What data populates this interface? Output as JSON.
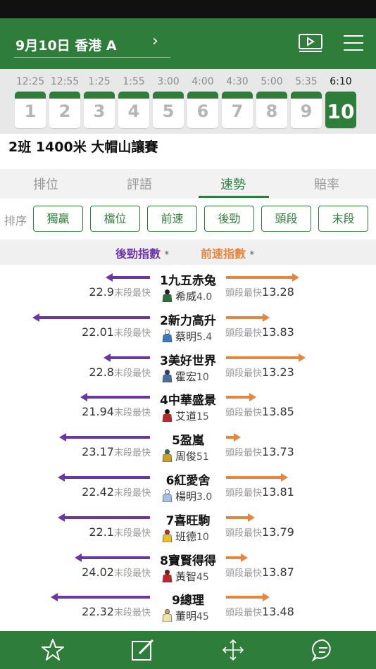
{
  "header": {
    "meeting": "9月10日 香港 A",
    "meeting_arrow": "›",
    "icons": [
      "video-icon",
      "menu-icon"
    ]
  },
  "races": [
    {
      "time": "12:25",
      "num": "1",
      "active": false
    },
    {
      "time": "12:55",
      "num": "2",
      "active": false
    },
    {
      "time": "1:25",
      "num": "3",
      "active": false
    },
    {
      "time": "1:55",
      "num": "4",
      "active": false
    },
    {
      "time": "3:00",
      "num": "5",
      "active": false
    },
    {
      "time": "4:00",
      "num": "6",
      "active": false
    },
    {
      "time": "4:30",
      "num": "7",
      "active": false
    },
    {
      "time": "5:00",
      "num": "8",
      "active": false
    },
    {
      "time": "5:35",
      "num": "9",
      "active": false
    },
    {
      "time": "6:10",
      "num": "10",
      "active": true
    }
  ],
  "race_title": "2班 1400米 大帽山讓賽",
  "tabs": [
    "排位",
    "評語",
    "速勢",
    "賠率"
  ],
  "active_tab": "速勢",
  "sort": {
    "label": "排序",
    "buttons": [
      "獨贏",
      "檔位",
      "前速",
      "後勁",
      "頭段",
      "末段"
    ]
  },
  "legend": {
    "late": "後勁指數",
    "early": "前速指數",
    "star": "*"
  },
  "captions": {
    "late": "末段最快",
    "early": "頭段最快"
  },
  "colors": {
    "brand": "#2e7d3a",
    "late": "#6b35a8",
    "early": "#e8843c"
  },
  "horses": [
    {
      "name": "1九五赤兔",
      "jockey": "希威",
      "weight": "4.0",
      "late": "22.9",
      "early": "13.28",
      "late_arrow": 0.37,
      "early_arrow": 0.74,
      "silk": [
        "#2f6f3a",
        "#222"
      ]
    },
    {
      "name": "2新力高升",
      "jockey": "蔡明",
      "weight": "5.4",
      "late": "22.01",
      "early": "13.83",
      "late_arrow": 0.98,
      "early_arrow": 0.44,
      "silk": [
        "#3a7bbf",
        "#fff"
      ]
    },
    {
      "name": "3美好世界",
      "jockey": "霍宏",
      "weight": "10",
      "late": "22.8",
      "early": "13.23",
      "late_arrow": 0.39,
      "early_arrow": 0.81,
      "silk": [
        "#4a6fa0",
        "#2a3f60"
      ]
    },
    {
      "name": "4中華盛景",
      "jockey": "艾道",
      "weight": "15",
      "late": "21.94",
      "early": "13.85",
      "late_arrow": 0.58,
      "early_arrow": 0.31,
      "silk": [
        "#c0272d",
        "#111"
      ]
    },
    {
      "name": "5盈嵐",
      "jockey": "周俊",
      "weight": "51",
      "late": "23.17",
      "early": "13.73",
      "late_arrow": 0.76,
      "early_arrow": 0.15,
      "silk": [
        "#c9a227",
        "#3a6e5a"
      ]
    },
    {
      "name": "6紅愛舍",
      "jockey": "楊明",
      "weight": "3.0",
      "late": "22.42",
      "early": "13.81",
      "late_arrow": 0.77,
      "early_arrow": 0.63,
      "silk": [
        "#9ec3e6",
        "#ffffff"
      ]
    },
    {
      "name": "7喜旺駒",
      "jockey": "班德",
      "weight": "10",
      "late": "22.1",
      "early": "13.79",
      "late_arrow": 0.77,
      "early_arrow": 0.29,
      "silk": [
        "#e6c12a",
        "#c0272d"
      ]
    },
    {
      "name": "8寶賢得得",
      "jockey": "黃智",
      "weight": "45",
      "late": "24.02",
      "early": "13.87",
      "late_arrow": 0.63,
      "early_arrow": 0.22,
      "silk": [
        "#c0272d",
        "#7a1a1a"
      ]
    },
    {
      "name": "9總理",
      "jockey": "董明",
      "weight": "45",
      "late": "22.32",
      "early": "13.48",
      "late_arrow": 0.83,
      "early_arrow": 0.44,
      "silk": [
        "#f2e2a8",
        "#c9a060"
      ]
    }
  ],
  "footer": {
    "icons": [
      "star-icon",
      "edit-icon",
      "move-icon",
      "chat-icon"
    ]
  }
}
